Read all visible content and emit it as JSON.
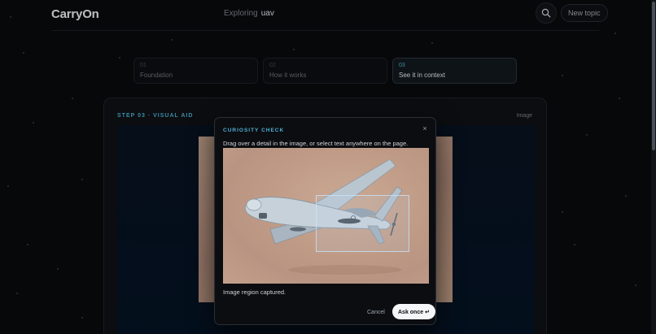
{
  "header": {
    "brand": "CarryOn",
    "exploring_label": "Exploring",
    "topic": "uav",
    "search_icon": "search-icon",
    "new_topic_label": "New topic"
  },
  "steps": [
    {
      "num": "01",
      "label": "Foundation",
      "active": false
    },
    {
      "num": "02",
      "label": "How it works",
      "active": false
    },
    {
      "num": "03",
      "label": "See it in context",
      "active": true
    }
  ],
  "card": {
    "title": "STEP 03 · VISUAL AID",
    "tag": "Image"
  },
  "modal": {
    "title": "CURIOSITY CHECK",
    "close_icon": "close-icon",
    "close_label": "×",
    "description": "Drag over a detail in the image, or select text anywhere on the page.",
    "status": "Image region captured.",
    "cancel_label": "Cancel",
    "ask_label": "Ask once ↵"
  },
  "colors": {
    "accent": "#4fb1d6",
    "background": "#0a0b0d",
    "primary_button": "#f5f6f8"
  }
}
